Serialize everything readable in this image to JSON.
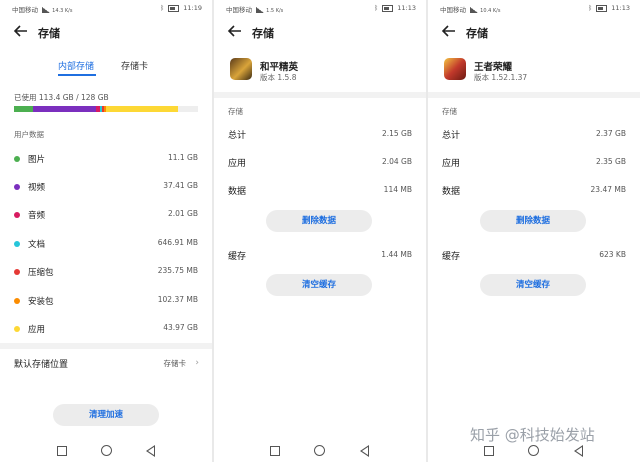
{
  "status": {
    "p1": {
      "carrier": "中国移动",
      "net": "14.3 K/s",
      "time": "11:19"
    },
    "p2": {
      "carrier": "中国移动",
      "net": "1.5 K/s",
      "time": "11:13"
    },
    "p3": {
      "carrier": "中国移动",
      "net": "10.4 K/s",
      "time": "11:13"
    }
  },
  "panel1": {
    "title": "存储",
    "tabs": [
      {
        "label": "内部存储",
        "active": true
      },
      {
        "label": "存储卡",
        "active": false
      }
    ],
    "used_text": "已使用 113.4 GB / 128 GB",
    "usage_fraction": 0.886,
    "section_label": "用户数据",
    "items": [
      {
        "label": "图片",
        "value": "11.1 GB",
        "color": "#4caf50"
      },
      {
        "label": "视频",
        "value": "37.41 GB",
        "color": "#7b2fbe"
      },
      {
        "label": "音频",
        "value": "2.01 GB",
        "color": "#d81b60"
      },
      {
        "label": "文档",
        "value": "646.91 MB",
        "color": "#26c6da"
      },
      {
        "label": "压缩包",
        "value": "235.75 MB",
        "color": "#e53935"
      },
      {
        "label": "安装包",
        "value": "102.37 MB",
        "color": "#fb8c00"
      },
      {
        "label": "应用",
        "value": "43.97 GB",
        "color": "#fdd835"
      }
    ],
    "default_location_label": "默认存储位置",
    "default_location_value": "存储卡",
    "clean_button": "清理加速"
  },
  "panel2": {
    "title": "存储",
    "app_name": "和平精英",
    "app_version": "版本 1.5.8",
    "section_label": "存储",
    "rows": [
      {
        "label": "总计",
        "value": "2.15 GB"
      },
      {
        "label": "应用",
        "value": "2.04 GB"
      },
      {
        "label": "数据",
        "value": "114 MB"
      }
    ],
    "delete_button": "删除数据",
    "cache_label": "缓存",
    "cache_value": "1.44 MB",
    "clear_cache_button": "清空缓存"
  },
  "panel3": {
    "title": "存储",
    "app_name": "王者荣耀",
    "app_version": "版本 1.52.1.37",
    "section_label": "存储",
    "rows": [
      {
        "label": "总计",
        "value": "2.37 GB"
      },
      {
        "label": "应用",
        "value": "2.35 GB"
      },
      {
        "label": "数据",
        "value": "23.47 MB"
      }
    ],
    "delete_button": "删除数据",
    "cache_label": "缓存",
    "cache_value": "623 KB",
    "clear_cache_button": "清空缓存"
  },
  "watermark": "知乎 @科技始发站",
  "colors": {
    "accent": "#1f6fe0",
    "pill_bg": "#ececec"
  }
}
